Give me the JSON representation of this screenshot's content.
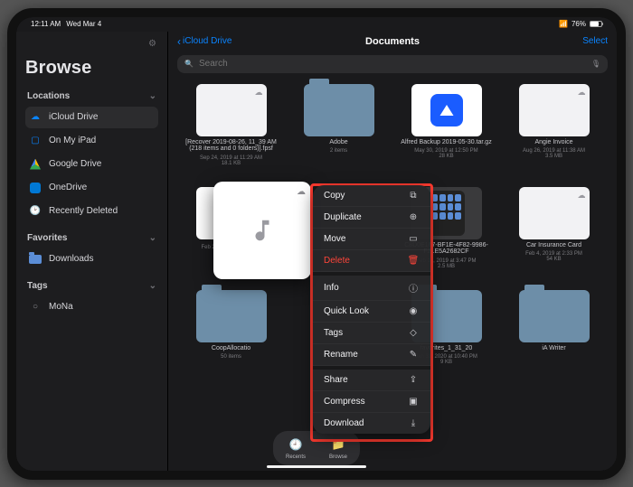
{
  "status": {
    "time": "12:11 AM",
    "date": "Wed Mar 4",
    "battery_pct": "76%"
  },
  "sidebar": {
    "title": "Browse",
    "sections": {
      "locations_label": "Locations",
      "favorites_label": "Favorites",
      "tags_label": "Tags"
    },
    "locations": [
      {
        "icon": "cloud",
        "label": "iCloud Drive"
      },
      {
        "icon": "ipad",
        "label": "On My iPad"
      },
      {
        "icon": "gdrive",
        "label": "Google Drive"
      },
      {
        "icon": "od",
        "label": "OneDrive"
      },
      {
        "icon": "clock",
        "label": "Recently Deleted"
      }
    ],
    "favorites": [
      {
        "icon": "folder",
        "label": "Downloads"
      }
    ],
    "tags": [
      {
        "icon": "tag",
        "label": "MoNa"
      }
    ]
  },
  "header": {
    "back_label": "iCloud Drive",
    "title": "Documents",
    "select_label": "Select",
    "search_placeholder": "Search"
  },
  "files": [
    {
      "name": "[Recover 2019-08-26, 11_39 AM (218 items and 0 folders)].fpsf",
      "meta": "Sep 24, 2019 at 11:29 AM\n18.1 KB",
      "kind": "doc"
    },
    {
      "name": "Adobe",
      "meta": "2 items",
      "kind": "folder"
    },
    {
      "name": "Alfred Backup 2019-05-30.tar.gz",
      "meta": "May 30, 2019 at 12:50 PM\n28 KB",
      "kind": "app"
    },
    {
      "name": "Angie Invoice",
      "meta": "Aug 26, 2019 at 11:38 AM\n3.5 MB",
      "kind": "doc"
    },
    {
      "name": "",
      "meta": "Feb 29, 2019 at 2:54 PM\n3.4 MB",
      "kind": "music"
    },
    {
      "name": "",
      "meta": "",
      "kind": "blank"
    },
    {
      "name": "C8D0E167-BF1E-4F82-9986-F21E5A2682CF",
      "meta": "Feb 15, 2019 at 3:47 PM\n2.5 MB",
      "kind": "phone"
    },
    {
      "name": "Car Insurance Card",
      "meta": "Feb 4, 2019 at 2:33 PM\n54 KB",
      "kind": "doc"
    },
    {
      "name": "CoopAllocatio",
      "meta": "50 items",
      "kind": "folder"
    },
    {
      "name": "",
      "meta": "",
      "kind": "blank"
    },
    {
      "name": "favorites_1_31_20",
      "meta": "Jan 31, 2020 at 10:40 PM\n9 KB",
      "kind": "folder"
    },
    {
      "name": "iA Writer",
      "meta": "",
      "kind": "folder"
    }
  ],
  "context_menu": [
    {
      "label": "Copy",
      "icon": "⧉",
      "kind": "normal"
    },
    {
      "label": "Duplicate",
      "icon": "⊕",
      "kind": "normal"
    },
    {
      "label": "Move",
      "icon": "▭",
      "kind": "normal"
    },
    {
      "label": "Delete",
      "icon": "🗑",
      "kind": "destructive"
    },
    {
      "sep": true
    },
    {
      "label": "Info",
      "icon": "ⓘ",
      "kind": "normal"
    },
    {
      "label": "Quick Look",
      "icon": "◉",
      "kind": "normal"
    },
    {
      "label": "Tags",
      "icon": "◇",
      "kind": "normal"
    },
    {
      "label": "Rename",
      "icon": "✎",
      "kind": "normal"
    },
    {
      "sep": true
    },
    {
      "label": "Share",
      "icon": "⇪",
      "kind": "normal"
    },
    {
      "label": "Compress",
      "icon": "▣",
      "kind": "normal"
    },
    {
      "label": "Download",
      "icon": "⤓",
      "kind": "normal"
    }
  ],
  "dock": {
    "recents_label": "Recents",
    "browse_label": "Browse"
  }
}
